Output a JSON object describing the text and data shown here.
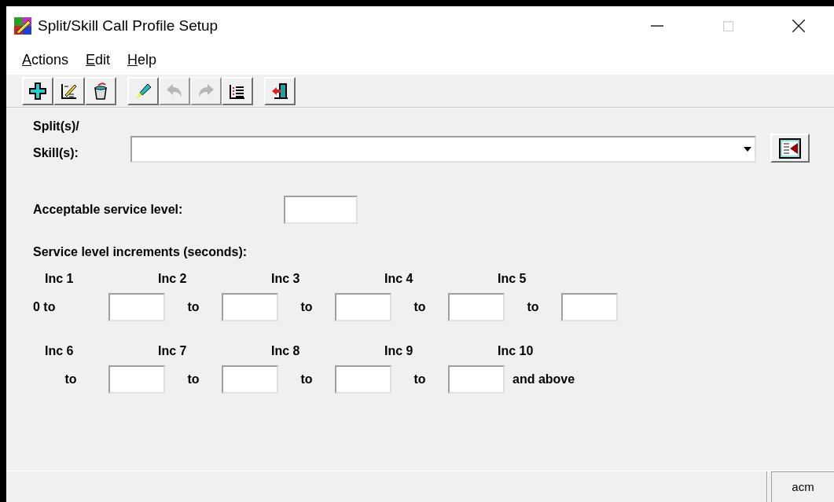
{
  "window": {
    "title": "Split/Skill Call Profile Setup",
    "controls": [
      {
        "kind": "minimize",
        "disabled": false
      },
      {
        "kind": "maximize",
        "disabled": true
      },
      {
        "kind": "close",
        "disabled": false
      }
    ]
  },
  "menu": [
    {
      "label": "Actions"
    },
    {
      "label": "Edit"
    },
    {
      "label": "Help"
    }
  ],
  "toolbar": [
    [
      {
        "kind": "add",
        "disabled": false
      },
      {
        "kind": "modify",
        "disabled": false
      },
      {
        "kind": "delete",
        "disabled": false
      }
    ],
    [
      {
        "kind": "clear",
        "disabled": false
      },
      {
        "kind": "undo",
        "disabled": true
      },
      {
        "kind": "redo",
        "disabled": true
      },
      {
        "kind": "list",
        "disabled": false
      }
    ],
    [
      {
        "kind": "exit",
        "disabled": false
      }
    ]
  ],
  "skills": {
    "label_lines": [
      "Split(s)/",
      "Skill(s):"
    ]
  },
  "acceptable_service_level": {
    "label": "Acceptable service level:"
  },
  "increments": {
    "heading": "Service level increments (seconds):",
    "rows": [
      {
        "labels": [
          "Inc 1",
          "Inc 2",
          "Inc 3",
          "Inc 4",
          "Inc 5"
        ],
        "cells": [
          {
            "kind": "text",
            "text": "0 to"
          },
          {
            "kind": "field"
          },
          {
            "kind": "text",
            "text": "to"
          },
          {
            "kind": "field"
          },
          {
            "kind": "text",
            "text": "to"
          },
          {
            "kind": "field"
          },
          {
            "kind": "text",
            "text": "to"
          },
          {
            "kind": "field"
          },
          {
            "kind": "text",
            "text": "to"
          },
          {
            "kind": "field"
          }
        ]
      },
      {
        "labels": [
          "Inc 6",
          "Inc 7",
          "Inc 8",
          "Inc 9",
          "Inc 10"
        ],
        "cells": [
          {
            "kind": "text",
            "text": "to"
          },
          {
            "kind": "field"
          },
          {
            "kind": "text",
            "text": "to"
          },
          {
            "kind": "field"
          },
          {
            "kind": "text",
            "text": "to"
          },
          {
            "kind": "field"
          },
          {
            "kind": "text",
            "text": "to"
          },
          {
            "kind": "field"
          },
          {
            "kind": "text",
            "text": "and above"
          }
        ]
      }
    ]
  },
  "status_bar": {
    "user": "acm"
  }
}
